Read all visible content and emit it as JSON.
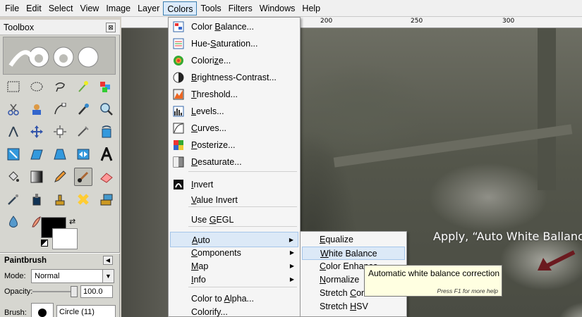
{
  "menubar": {
    "items": [
      {
        "label": "File"
      },
      {
        "label": "Edit"
      },
      {
        "label": "Select"
      },
      {
        "label": "View"
      },
      {
        "label": "Image"
      },
      {
        "label": "Layer"
      },
      {
        "label": "Colors"
      },
      {
        "label": "Tools"
      },
      {
        "label": "Filters"
      },
      {
        "label": "Windows"
      },
      {
        "label": "Help"
      }
    ],
    "active": "Colors"
  },
  "ruler": {
    "labels": [
      "200",
      "250",
      "300"
    ]
  },
  "toolbox": {
    "title": "Toolbox",
    "close_glyph": "⊠",
    "tool_options": {
      "title": "Paintbrush",
      "mode_label": "Mode:",
      "mode_value": "Normal",
      "opacity_label": "Opacity:",
      "opacity_value": "100.0",
      "opacity_fraction": 1.0,
      "brush_label": "Brush:",
      "brush_value": "Circle (11)"
    }
  },
  "colors_menu": {
    "items": [
      {
        "pre": "Color ",
        "ul": "B",
        "post": "alance...",
        "icon": "color-balance-icon"
      },
      {
        "pre": "Hue-",
        "ul": "S",
        "post": "aturation...",
        "icon": "hue-saturation-icon"
      },
      {
        "pre": "Colori",
        "ul": "z",
        "post": "e...",
        "icon": "colorize-icon"
      },
      {
        "pre": "",
        "ul": "B",
        "post": "rightness-Contrast...",
        "icon": "brightness-contrast-icon"
      },
      {
        "pre": "",
        "ul": "T",
        "post": "hreshold...",
        "icon": "threshold-icon"
      },
      {
        "pre": "",
        "ul": "L",
        "post": "evels...",
        "icon": "levels-icon"
      },
      {
        "pre": "",
        "ul": "C",
        "post": "urves...",
        "icon": "curves-icon"
      },
      {
        "pre": "",
        "ul": "P",
        "post": "osterize...",
        "icon": "posterize-icon"
      },
      {
        "pre": "",
        "ul": "D",
        "post": "esaturate...",
        "icon": "desaturate-icon"
      },
      {
        "pre": "",
        "ul": "I",
        "post": "nvert",
        "icon": "invert-icon"
      },
      {
        "pre": "",
        "ul": "V",
        "post": "alue Invert",
        "icon": ""
      },
      {
        "pre": "Use ",
        "ul": "G",
        "post": "EGL",
        "icon": ""
      },
      {
        "pre": "",
        "ul": "A",
        "post": "uto",
        "icon": "",
        "submenu": true
      },
      {
        "pre": "",
        "ul": "C",
        "post": "omponents",
        "icon": "",
        "submenu": true
      },
      {
        "pre": "",
        "ul": "M",
        "post": "ap",
        "icon": "",
        "submenu": true
      },
      {
        "pre": "",
        "ul": "I",
        "post": "nfo",
        "icon": "",
        "submenu": true
      },
      {
        "pre": "Color to ",
        "ul": "A",
        "post": "lpha...",
        "icon": ""
      },
      {
        "pre": "Colorify...",
        "ul": "",
        "post": "",
        "icon": ""
      }
    ]
  },
  "auto_menu": {
    "items": [
      {
        "pre": "",
        "ul": "E",
        "post": "qualize"
      },
      {
        "pre": "",
        "ul": "W",
        "post": "hite Balance"
      },
      {
        "pre": "",
        "ul": "C",
        "post": "olor Enhance"
      },
      {
        "pre": "",
        "ul": "N",
        "post": "ormalize"
      },
      {
        "pre": "Stretch ",
        "ul": "C",
        "post": "ontrast..."
      },
      {
        "pre": "Stretch ",
        "ul": "H",
        "post": "SV"
      }
    ]
  },
  "tooltip": {
    "text": "Automatic white balance correction",
    "hint": "Press F1 for more help"
  },
  "annotation": {
    "text": "Apply, “Auto White Ballance”"
  },
  "colors": {
    "annotation_arrow": "#6b1a1f",
    "menu_highlight": "#dce9f7"
  }
}
